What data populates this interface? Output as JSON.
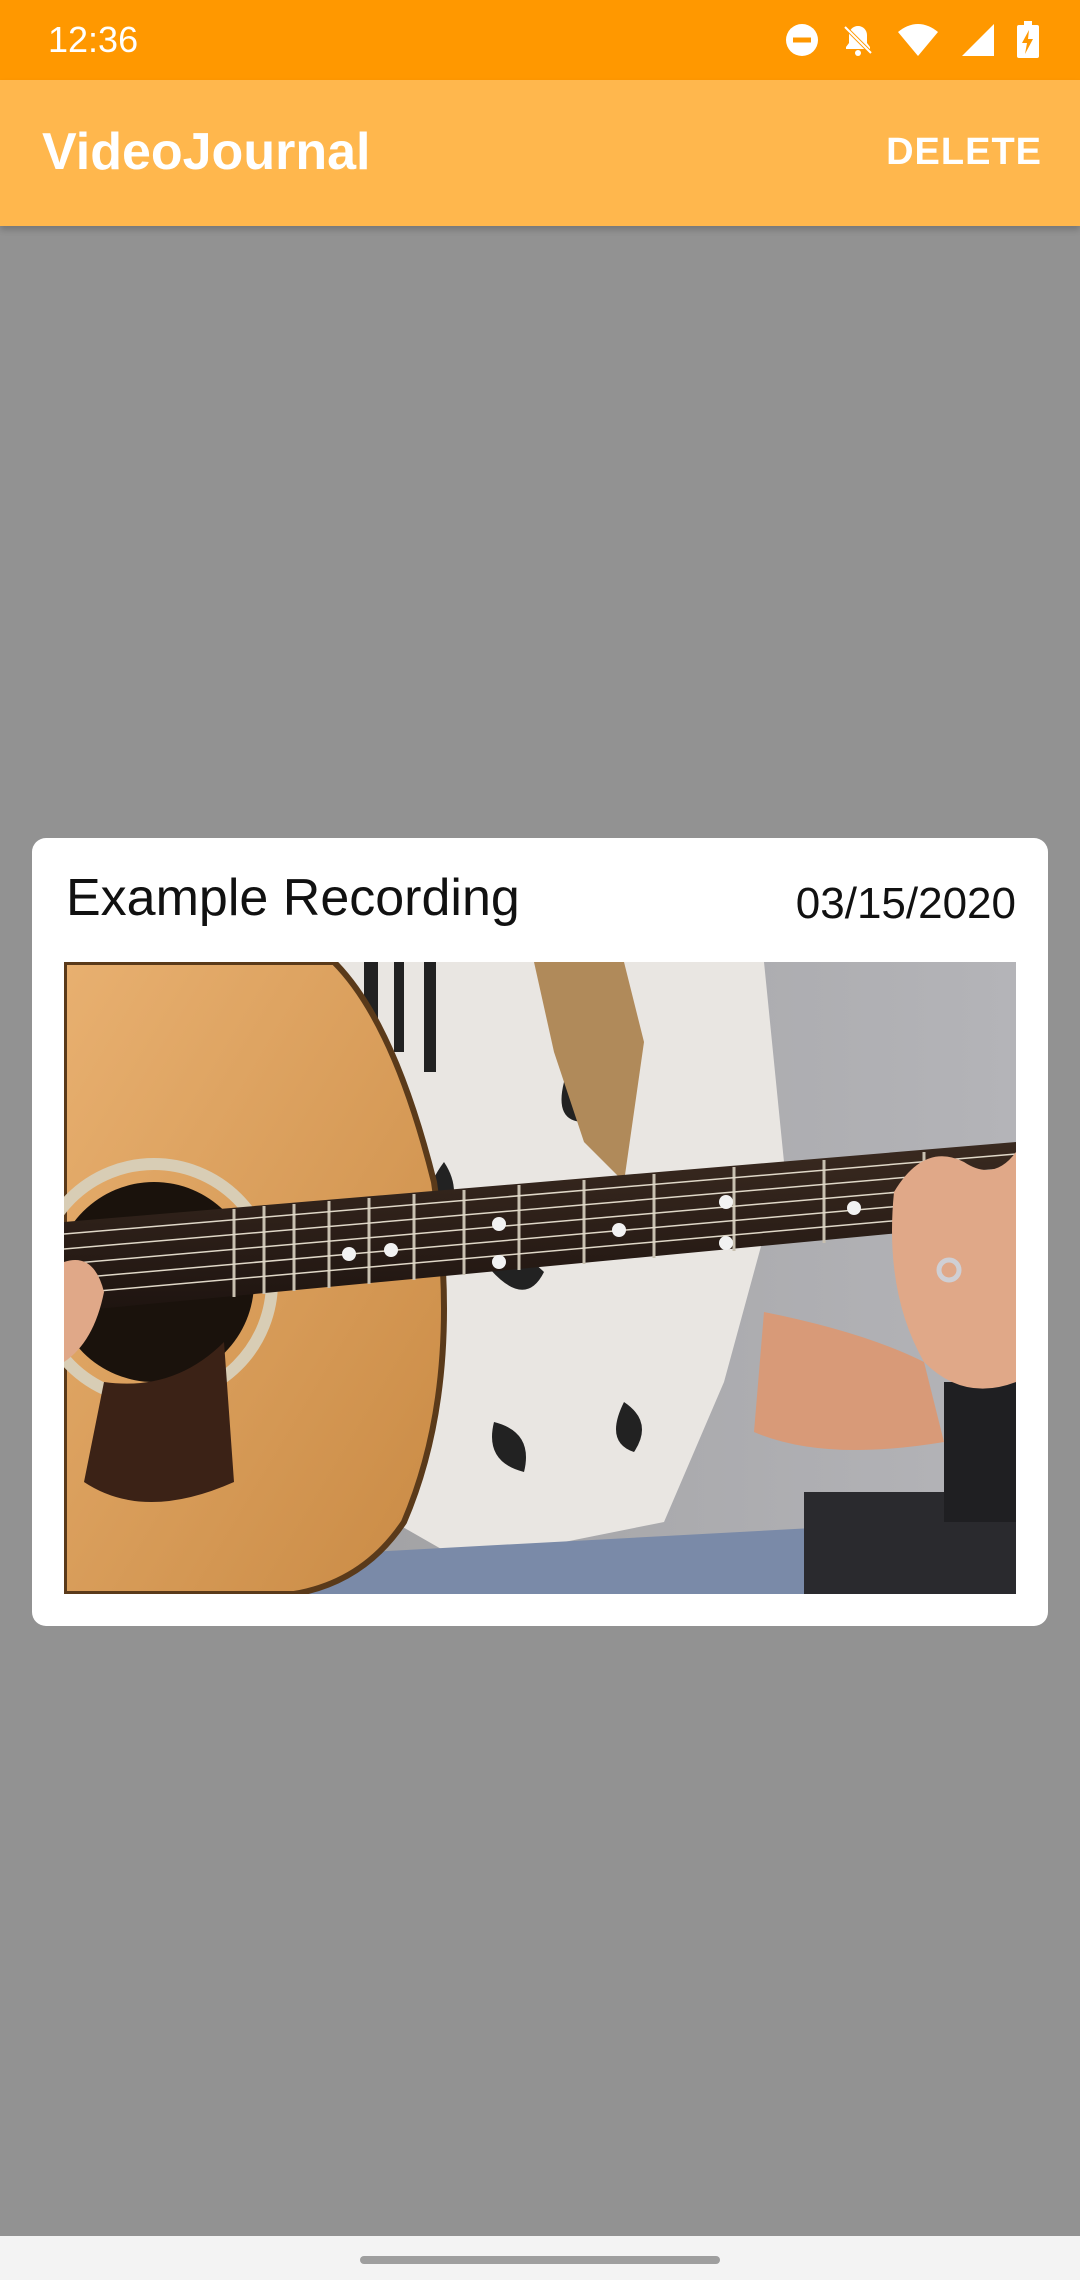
{
  "status_bar": {
    "time": "12:36",
    "icons": [
      "do-not-disturb-icon",
      "notifications-off-icon",
      "wifi-icon",
      "signal-icon",
      "battery-charging-icon"
    ]
  },
  "app_bar": {
    "title": "VideoJournal",
    "delete_label": "DELETE"
  },
  "recording": {
    "title": "Example Recording",
    "date": "03/15/2020",
    "thumbnail": "guitar-video-thumbnail"
  },
  "colors": {
    "status_bar": "#FF9800",
    "app_bar": "#FFB74D",
    "scrim_background": "#929292",
    "card": "#FFFFFF"
  }
}
